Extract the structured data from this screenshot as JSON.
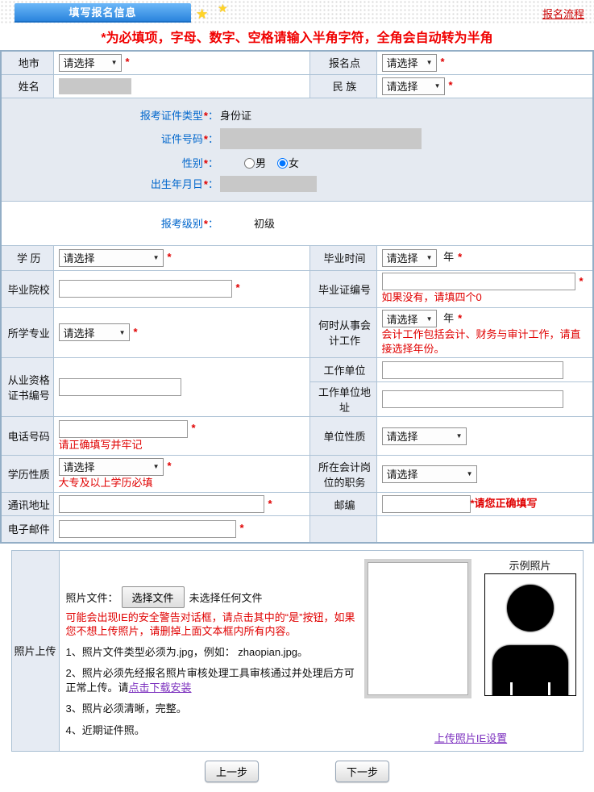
{
  "icons": {
    "dropdown": "▼",
    "star": "★"
  },
  "header": {
    "tab": "填写报名信息",
    "flow_link": "报名流程"
  },
  "notice": "*为必填项，字母、数字、空格请输入半角字符，全角会自动转为半角",
  "common": {
    "select_placeholder": "请选择",
    "required": "*",
    "year": "年",
    "colon": "："
  },
  "rows": {
    "city": {
      "label": "地市"
    },
    "site": {
      "label": "报名点"
    },
    "name": {
      "label": "姓名"
    },
    "ethnic": {
      "label": "民 族"
    },
    "cert": {
      "type_label": "报考证件类型",
      "type_value": "身份证",
      "id_label": "证件号码",
      "gender_label": "性别",
      "male": "男",
      "female": "女",
      "birth_label": "出生年月日"
    },
    "level": {
      "label": "报考级别",
      "value": "初级"
    },
    "edu": {
      "label": "学 历"
    },
    "grad_year": {
      "label": "毕业时间"
    },
    "school": {
      "label": "毕业院校"
    },
    "diploma": {
      "label": "毕业证编号",
      "hint": "如果没有，请填四个0"
    },
    "major": {
      "label": "所学专业"
    },
    "work_since": {
      "label": "何时从事会计工作",
      "hint": "会计工作包括会计、财务与审计工作，请直接选择年份。"
    },
    "cert_no": {
      "label": "从业资格证书编号"
    },
    "employer": {
      "label": "工作单位"
    },
    "employer_addr": {
      "label": "工作单位地址"
    },
    "phone": {
      "label": "电话号码",
      "hint": "请正确填写并牢记"
    },
    "unit_type": {
      "label": "单位性质"
    },
    "edu_nature": {
      "label": "学历性质",
      "hint": "大专及以上学历必填"
    },
    "position": {
      "label": "所在会计岗位的职务"
    },
    "address": {
      "label": "通讯地址"
    },
    "zip": {
      "label": "邮编",
      "hint": "*请您正确填写"
    },
    "email": {
      "label": "电子邮件"
    }
  },
  "photo": {
    "section_label": "照片上传",
    "file_label": "照片文件：",
    "choose_button": "选择文件",
    "no_file": "未选择任何文件",
    "warning": "可能会出现IE的安全警告对话框，请点击其中的“是”按钮，如果您不想上传照片，请删掉上面文本框内所有内容。",
    "instr1": "1、照片文件类型必须为.jpg，例如： zhaopian.jpg。",
    "instr2_prefix": "2、照片必须先经报名照片审核处理工具审核通过并处理后方可正常上传。请",
    "instr2_link": "点击下载安装",
    "instr3": "3、照片必须清晰，完整。",
    "instr4": "4、近期证件照。",
    "sample_label": "示例照片",
    "ie_link": "上传照片IE设置"
  },
  "buttons": {
    "prev": "上一步",
    "next": "下一步"
  }
}
